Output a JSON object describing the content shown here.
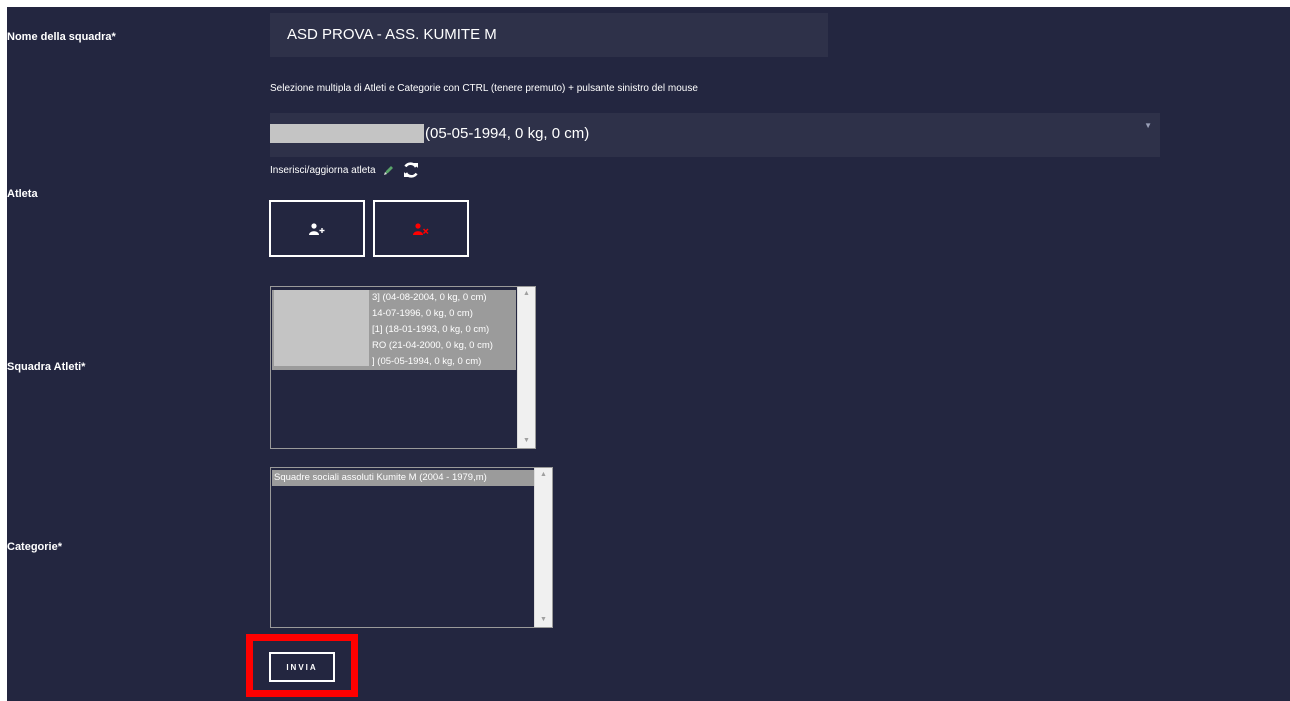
{
  "labels": {
    "team_name": "Nome della squadra*",
    "athlete": "Atleta",
    "team_athletes": "Squadra Atleti*",
    "categories": "Categorie*"
  },
  "team_name_value": "ASD PROVA - ASS. KUMITE M",
  "hint": "Selezione multipla di Atleti e Categorie con CTRL (tenere premuto) + pulsante sinistro del mouse",
  "athlete_select": {
    "selected_value": "(05-05-1994, 0 kg, 0 cm)"
  },
  "update_athlete_link": "Inserisci/aggiorna atleta",
  "icons": {
    "add": "add-user-icon",
    "remove": "remove-user-icon",
    "edit": "edit-icon",
    "refresh": "refresh-icon"
  },
  "colors": {
    "background": "#232640",
    "field": "#2e3149",
    "selected_option": "#9b9b9b",
    "remove_icon": "#ff0000",
    "highlight": "#ff0000"
  },
  "team_athletes_options": [
    "3] (04-08-2004, 0 kg, 0 cm)",
    "14-07-1996, 0 kg, 0 cm)",
    "[1] (18-01-1993, 0 kg, 0 cm)",
    "RO (21-04-2000, 0 kg, 0 cm)",
    "] (05-05-1994, 0 kg, 0 cm)"
  ],
  "categories_options": [
    "Squadre sociali assoluti Kumite M (2004 - 1979,m)"
  ],
  "submit_label": "INVIA"
}
